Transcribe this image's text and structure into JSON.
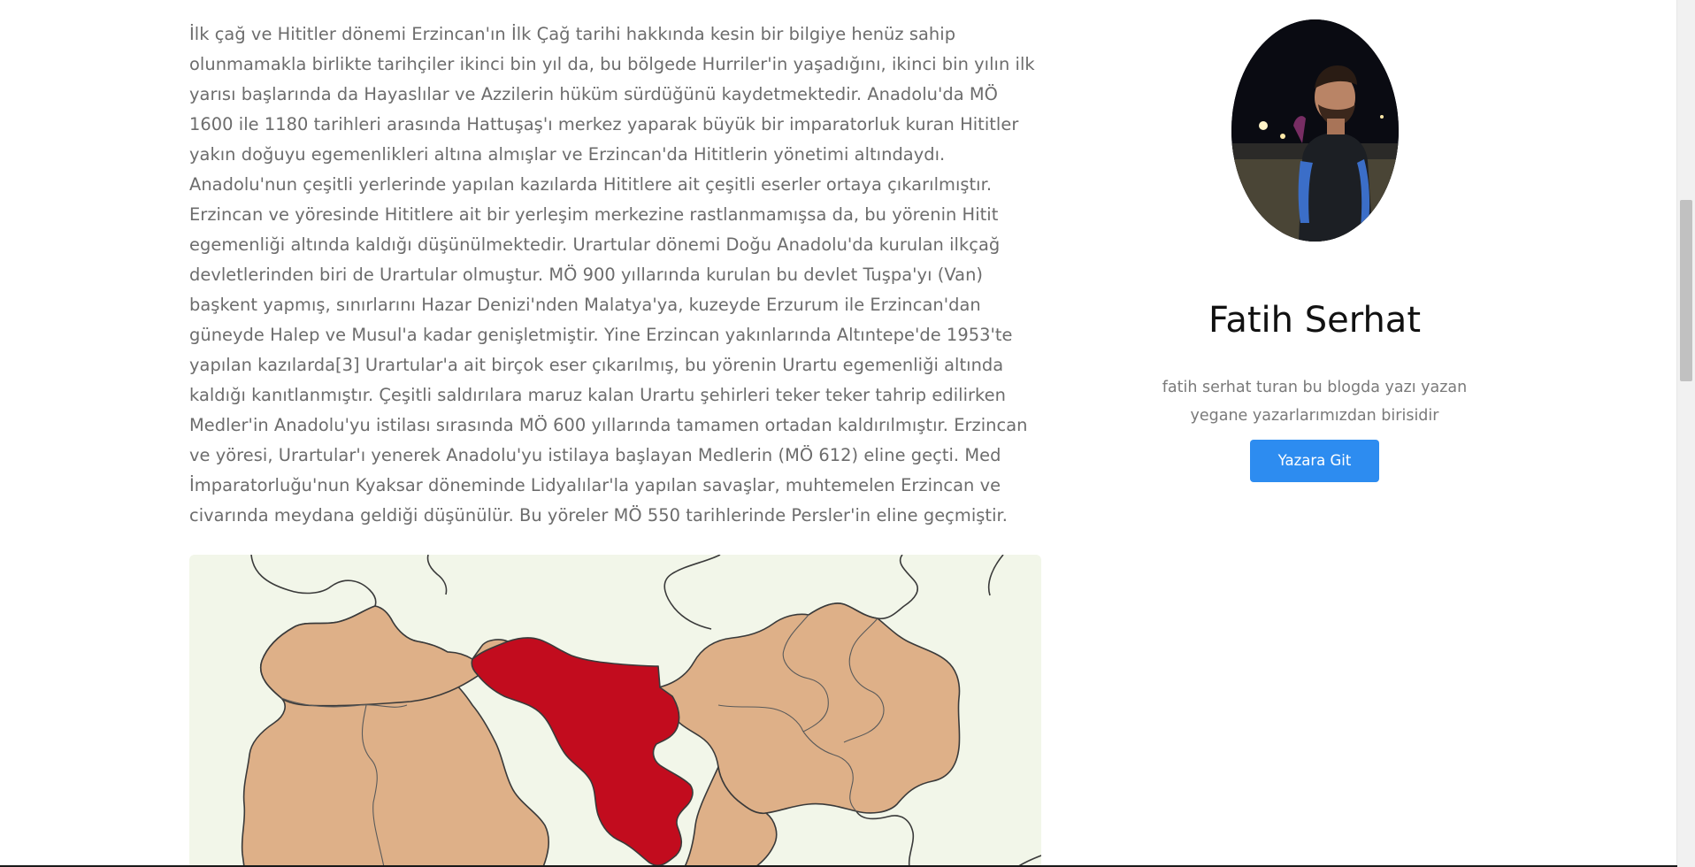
{
  "article": {
    "paragraph": "İlk çağ ve Hititler dönemi Erzincan'ın İlk Çağ tarihi hakkında kesin bir bilgiye henüz sahip olunmamakla birlikte tarihçiler ikinci bin yıl da, bu bölgede Hurriler'in yaşadığını, ikinci bin yılın ilk yarısı başlarında da Hayaslılar ve Azzilerin hüküm sürdüğünü kaydetmektedir. Anadolu'da MÖ 1600 ile 1180 tarihleri arasında Hattuşaş'ı merkez yaparak büyük bir imparatorluk kuran Hititler yakın doğuyu egemenlikleri altına almışlar ve Erzincan'da Hititlerin yönetimi altındaydı. Anadolu'nun çeşitli yerlerinde yapılan kazılarda Hititlere ait çeşitli eserler ortaya çıkarılmıştır. Erzincan ve yöresinde Hititlere ait bir yerleşim merkezine rastlanmamışsa da, bu yörenin Hitit egemenliği altında kaldığı düşünülmektedir. Urartular dönemi Doğu Anadolu'da kurulan ilkçağ devletlerinden biri de Urartular olmuştur. MÖ 900 yıllarında kurulan bu devlet Tuşpa'yı (Van) başkent yapmış, sınırlarını Hazar Denizi'nden Malatya'ya, kuzeyde Erzurum ile Erzincan'dan güneyde Halep ve Musul'a kadar genişletmiştir. Yine Erzincan yakınlarında Altıntepe'de 1953'te yapılan kazılarda[3] Urartular'a ait birçok eser çıkarılmış, bu yörenin Urartu egemenliği altında kaldığı kanıtlanmıştır. Çeşitli saldırılara maruz kalan Urartu şehirleri teker teker tahrip edilirken Medler'in Anadolu'yu istilası sırasında MÖ 600 yıllarında tamamen ortadan kaldırılmıştır. Erzincan ve yöresi, Urartular'ı yenerek Anadolu'yu istilaya başlayan Medlerin (MÖ 612) eline geçti. Med İmparatorluğu'nun Kyaksar döneminde Lidyalılar'la yapılan savaşlar, muhtemelen Erzincan ve civarında meydana geldiği düşünülür. Bu yöreler MÖ 550 tarihlerinde Persler'in eline geçmiştir."
  },
  "map": {
    "colors": {
      "background": "#f2f6e9",
      "region": "#deb088",
      "highlight": "#c20c1e",
      "border": "#3a3a3a"
    }
  },
  "author": {
    "name": "Fatih Serhat",
    "bio": "fatih serhat turan bu blogda yazı yazan yegane yazarlarımızdan birisidir",
    "button_label": "Yazara Git",
    "button_color": "#2d8cf0"
  }
}
